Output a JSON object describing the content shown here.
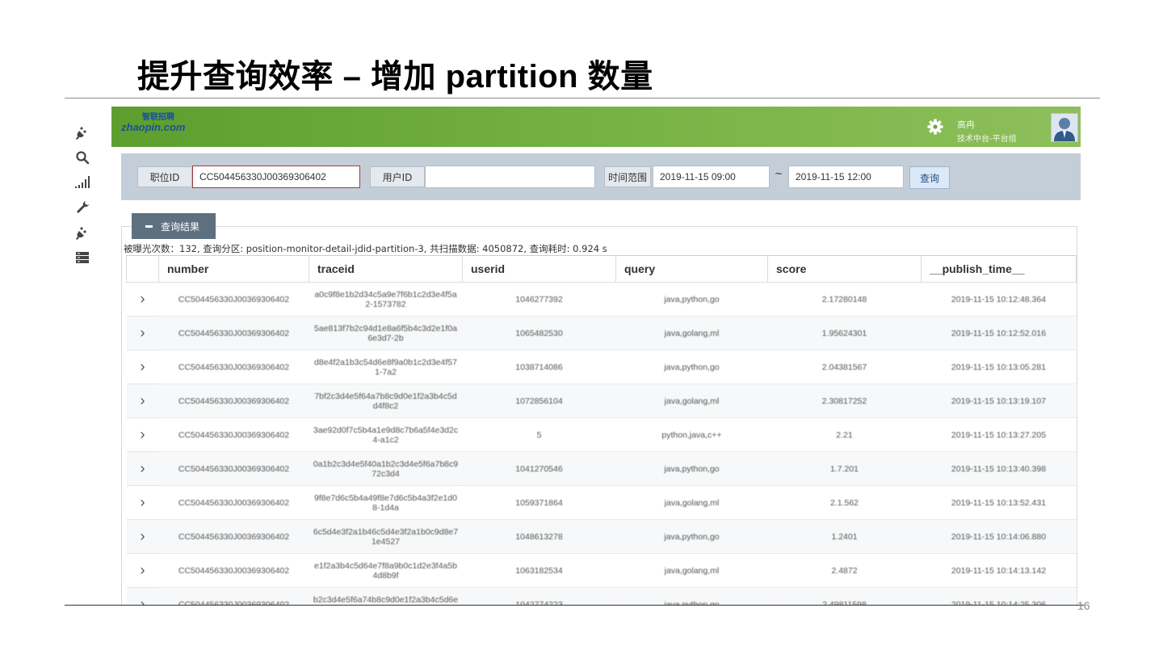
{
  "slide": {
    "title": "提升查询效率 – 增加 partition 数量",
    "page_number": "16"
  },
  "sidebar": {
    "icons": [
      "plug-icon",
      "search-icon",
      "signal-bars-icon",
      "wrench-icon",
      "plug-icon",
      "server-list-icon"
    ]
  },
  "app": {
    "logo_text": "zhaopin.com",
    "logo_cn": "智联招聘",
    "user": {
      "name": "高冉",
      "department": "技术中台-平台组"
    }
  },
  "filters": {
    "position_id_label": "职位ID",
    "position_id_value": "CC504456330J00369306402",
    "user_id_label": "用户ID",
    "user_id_value": "",
    "time_range_label": "时间范围",
    "time_start": "2019-11-15 09:00",
    "time_separator": "~",
    "time_end": "2019-11-15 12:00",
    "query_button": "查询"
  },
  "results": {
    "collapse_label": "查询结果",
    "summary": "被曝光次数：132, 查询分区: position-monitor-detail-jdid-partition-3, 共扫描数据: 4050872, 查询耗时: 0.924 s",
    "columns": [
      "number",
      "traceid",
      "userid",
      "query",
      "score",
      "__publish_time__"
    ],
    "rows": [
      [
        "CC504456330J00369306402",
        "a0c9f8e1b2d34c5a9e7f6b1c2d3e4f5a 2-1573782",
        "1046277392",
        "java,python,go",
        "2.17280148",
        "2019-11-15 10:12:48.364"
      ],
      [
        "CC504456330J00369306402",
        "5ae813f7b2c94d1e8a6f5b4c3d2e1f0a 6e3d7-2b",
        "1065482530",
        "java,golang,ml",
        "1.95624301",
        "2019-11-15 10:12:52.016"
      ],
      [
        "CC504456330J00369306402",
        "d8e4f2a1b3c54d6e8f9a0b1c2d3e4f57 1-7a2",
        "1038714086",
        "java,python,go",
        "2.04381567",
        "2019-11-15 10:13:05.281"
      ],
      [
        "CC504456330J00369306402",
        "7bf2c3d4e5f64a7b8c9d0e1f2a3b4c5d d4f8c2",
        "1072856104",
        "java,golang,ml",
        "2.30817252",
        "2019-11-15 10:13:19.107"
      ],
      [
        "CC504456330J00369306402",
        "3ae92d0f7c5b4a1e9d8c7b6a5f4e3d2c 4-a1c2",
        "5",
        "python,java,c++",
        "2.21",
        "2019-11-15 10:13:27.205"
      ],
      [
        "CC504456330J00369306402",
        "0a1b2c3d4e5f40a1b2c3d4e5f6a7b8c9 72c3d4",
        "1041270546",
        "java,python,go",
        "1.7.201",
        "2019-11-15 10:13:40.398"
      ],
      [
        "CC504456330J00369306402",
        "9f8e7d6c5b4a49f8e7d6c5b4a3f2e1d0 8-1d4a",
        "1059371864",
        "java,golang,ml",
        "2.1.562",
        "2019-11-15 10:13:52.431"
      ],
      [
        "CC504456330J00369306402",
        "6c5d4e3f2a1b46c5d4e3f2a1b0c9d8e7 1e4527",
        "1048613278",
        "java,python,go",
        "1.2401",
        "2019-11-15 10:14:06.880"
      ],
      [
        "CC504456330J00369306402",
        "e1f2a3b4c5d64e7f8a9b0c1d2e3f4a5b 4d8b9f",
        "1063182534",
        "java,golang,ml",
        "2.4872",
        "2019-11-15 10:14:13.142"
      ],
      [
        "CC504456330J00369306402",
        "b2c3d4e5f6a74b8c9d0e1f2a3b4c5d6e 2b-4312",
        "1042774223",
        "java,python,go",
        "2.49811598",
        "2019-11-15 10:14:25.306"
      ]
    ]
  },
  "colors": {
    "topbar_start": "#5d9e2e",
    "topbar_end": "#8ebf5b",
    "filter_bg": "#c4ced8",
    "collapse_btn": "#5e6f80",
    "input_highlight_border": "#a33a3a"
  }
}
